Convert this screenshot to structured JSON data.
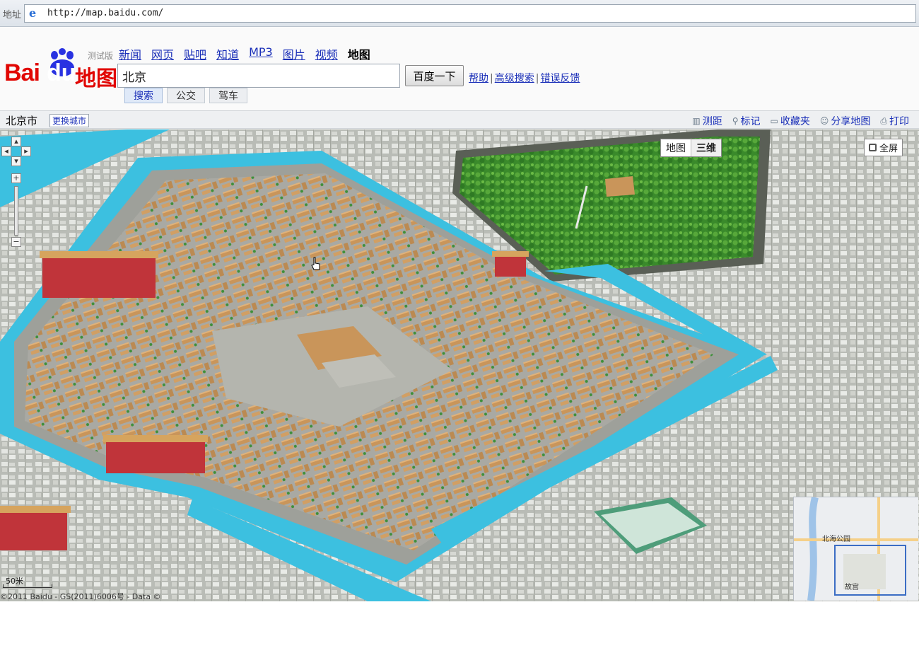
{
  "browser": {
    "address_label": "地址",
    "url": "http://map.baidu.com/"
  },
  "logo": {
    "bai": "Bai",
    "du": "du",
    "map": "地图",
    "beta": "测试版"
  },
  "topnav": [
    "新闻",
    "网页",
    "贴吧",
    "知道",
    "MP3",
    "图片",
    "视频",
    "地图"
  ],
  "search": {
    "value": "北京",
    "button": "百度一下"
  },
  "links": {
    "help": "帮助",
    "advanced": "高级搜索",
    "feedback": "错误反馈"
  },
  "subtabs": [
    "搜索",
    "公交",
    "驾车"
  ],
  "citybar": {
    "city": "北京市",
    "change_city": "更换城市",
    "tools": [
      "测距",
      "标记",
      "收藏夹",
      "分享地图",
      "打印"
    ]
  },
  "map": {
    "type_map": "地图",
    "type_3d": "三维",
    "fullscreen": "全屏",
    "scale": "50米",
    "copyright": "©2011 Baidu - GS(2011)6006号 - Data ©",
    "overview_labels": [
      "北海公园",
      "故宫"
    ]
  },
  "colors": {
    "baidu_red": "#e10602",
    "baidu_blue": "#2932e1",
    "link_blue": "#1a2fb8",
    "moat": "#3cc0e0",
    "roof": "#c9955a",
    "park": "#3f8f2e"
  }
}
